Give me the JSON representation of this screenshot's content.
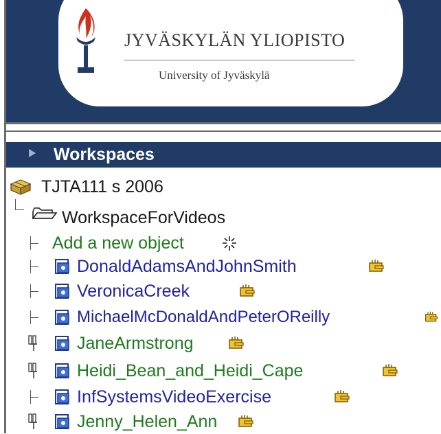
{
  "banner": {
    "university_name": "JYVÄSKYLÄN YLIOPISTO",
    "university_sub": "University of Jyväskylä"
  },
  "workspaces": {
    "title": "Workspaces"
  },
  "tree": {
    "course": "TJTA111 s 2006",
    "workspace": "WorkspaceForVideos",
    "add_label": "Add a new object",
    "items": [
      {
        "label": "DonaldAdamsAndJohnSmith",
        "color": "#23239e",
        "connector": "tee"
      },
      {
        "label": "VeronicaCreek",
        "color": "#23239e",
        "connector": "tee"
      },
      {
        "label": "MichaelMcDonaldAndPeterOReilly",
        "color": "#23239e",
        "connector": "tee"
      },
      {
        "label": "JaneArmstrong",
        "color": "#1f7a1f",
        "connector": "pin"
      },
      {
        "label": "Heidi_Bean_and_Heidi_Cape",
        "color": "#1f7a1f",
        "connector": "pin"
      },
      {
        "label": "InfSystemsVideoExercise",
        "color": "#23239e",
        "connector": "tee"
      },
      {
        "label": "Jenny_Helen_Ann",
        "color": "#1f7a1f",
        "connector": "pin"
      }
    ]
  },
  "colors": {
    "navy": "#1f3b66",
    "link_blue": "#23239e",
    "link_green": "#1f7a1f",
    "torch_flame": "#c8321e"
  }
}
